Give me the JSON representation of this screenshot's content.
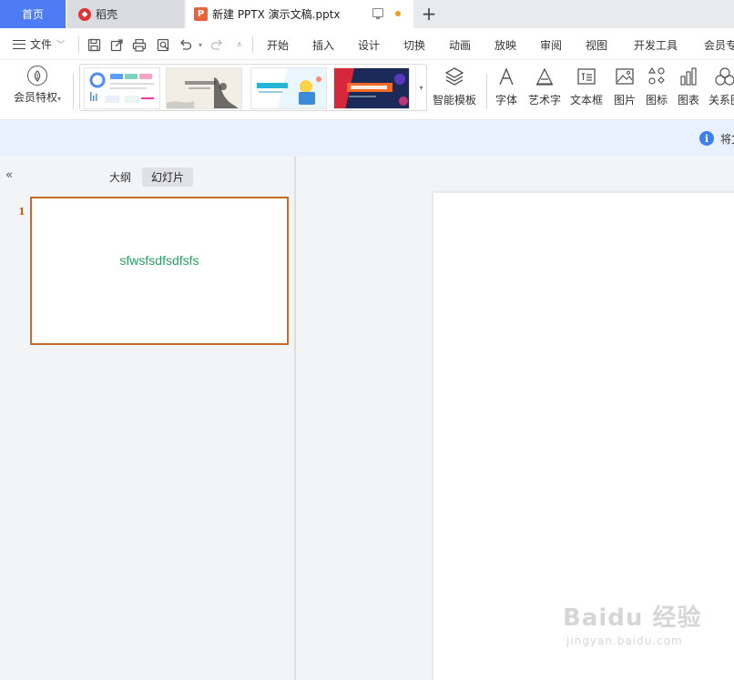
{
  "tabs": {
    "home": "首页",
    "daoke": "稻壳",
    "document": "新建 PPTX 演示文稿.pptx",
    "new_tab": "+"
  },
  "menu": {
    "file": "文件",
    "ribbon_tabs": [
      "开始",
      "插入",
      "设计",
      "切换",
      "动画",
      "放映",
      "审阅",
      "视图",
      "开发工具",
      "会员专"
    ]
  },
  "ribbon": {
    "vip_label": "会员特权",
    "smart_template": "智能模板",
    "tools": [
      "字体",
      "艺术字",
      "文本框",
      "图片",
      "图标",
      "图表",
      "关系图"
    ]
  },
  "infobar": {
    "text": "将文"
  },
  "left_panel": {
    "outline_tab": "大纲",
    "slides_tab": "幻灯片",
    "slide_number": "1",
    "slide_text": "sfwsfsdfsdfsfs"
  },
  "watermark": {
    "main": "Baidu 经验",
    "sub": "jingyan.baidu.com"
  },
  "colors": {
    "accent_blue": "#4d7bf3",
    "slide_border": "#c86a2a",
    "slide_text": "#27a35d",
    "info_blue": "#3f7ef0"
  }
}
